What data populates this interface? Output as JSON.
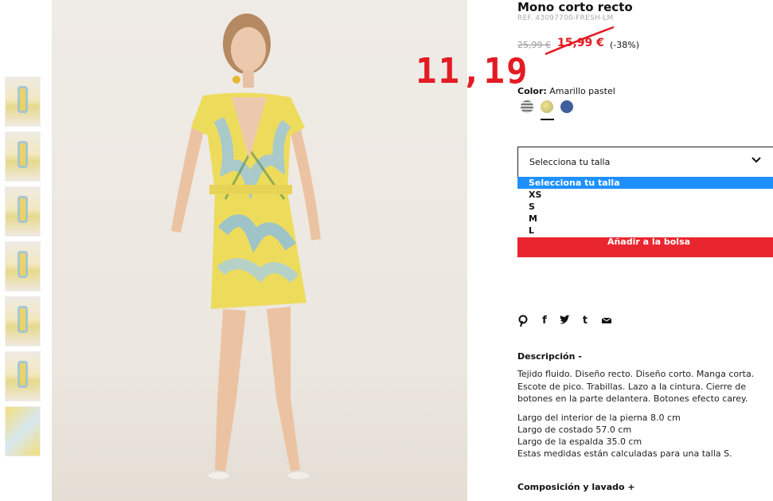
{
  "product": {
    "title": "Mono corto recto",
    "ref": "REF. 43097700-FRESH-LM",
    "old_price": "25,99 €",
    "sale_price": "15,99 €",
    "discount": "(-38%)",
    "handwritten_price": "11,19"
  },
  "color": {
    "label": "Color:",
    "value": "Amarillo pastel",
    "swatches": [
      "striped-grey",
      "yellow-floral",
      "navy-blue"
    ],
    "selected_index": 1
  },
  "size": {
    "placeholder": "Selecciona tu talla",
    "options": [
      "Selecciona tu talla",
      "XS",
      "S",
      "M",
      "L"
    ],
    "highlighted_index": 0
  },
  "add_to_bag": "Añadir a la bolsa",
  "social_icons": [
    "pinterest-icon",
    "facebook-icon",
    "twitter-icon",
    "tumblr-icon",
    "email-icon"
  ],
  "description": {
    "heading": "Descripción -",
    "text": "Tejido fluido. Diseño recto. Diseño corto. Manga corta. Escote de pico. Trabillas. Lazo a la cintura. Cierre de botones en la parte delantera. Botones efecto carey.",
    "measures": [
      "Largo del interior de la pierna 8.0 cm",
      "Largo de costado 57.0 cm",
      "Largo de la espalda 35.0 cm",
      "Estas medidas están calculadas para una talla S."
    ]
  },
  "composition_heading": "Composición y lavado +",
  "colors": {
    "accent_red": "#e31b23",
    "highlight_blue": "#1e90ff"
  }
}
